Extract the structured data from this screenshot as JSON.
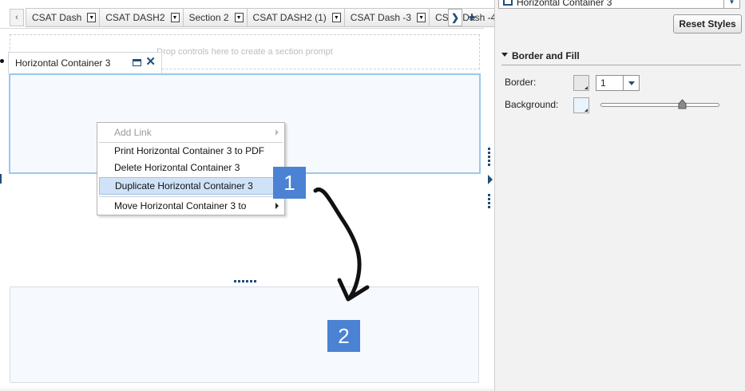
{
  "tabs": [
    {
      "label": "CSAT Dash"
    },
    {
      "label": "CSAT DASH2"
    },
    {
      "label": "Section 2"
    },
    {
      "label": "CSAT DASH2 (1)"
    },
    {
      "label": "CSAT Dash  -3"
    },
    {
      "label": "CSAT Dash  -4"
    }
  ],
  "canvas": {
    "prompt_placeholder": "Drop controls here to create a section prompt",
    "container_title": "Horizontal Container 3"
  },
  "context_menu": {
    "items": [
      {
        "label": "Add Link",
        "disabled": true,
        "has_submenu": true
      },
      {
        "label": "Print Horizontal Container 3 to PDF",
        "disabled": false,
        "has_submenu": false
      },
      {
        "label": "Delete Horizontal Container 3",
        "disabled": false,
        "has_submenu": false
      },
      {
        "label": "Duplicate Horizontal Container 3",
        "disabled": false,
        "has_submenu": false,
        "highlighted": true
      },
      {
        "label": "Move Horizontal Container 3 to",
        "disabled": false,
        "has_submenu": true
      }
    ]
  },
  "annotations": {
    "step1": "1",
    "step2": "2"
  },
  "panel": {
    "object_selector_value": "Horizontal Container 3",
    "reset_button": "Reset Styles",
    "section_title": "Border and Fill",
    "border_label": "Border:",
    "border_width_value": "1",
    "background_label": "Background:",
    "background_transparency_fraction": 0.69
  },
  "colors": {
    "accent": "#1f4e79",
    "badge": "#4b82d3",
    "menu_highlight": "#cfe2f7",
    "container_fill": "#f6f9fd",
    "selection_border": "#9cc7ec",
    "border_swatch": "#e8e8e8",
    "background_swatch": "#eaf4fb"
  },
  "icons": {
    "tab_scroll_left": "chevron-left-icon",
    "tab_scroll_right": "chevron-right-icon",
    "add_tab": "plus-icon",
    "maximize": "maximize-icon",
    "close": "close-icon"
  }
}
